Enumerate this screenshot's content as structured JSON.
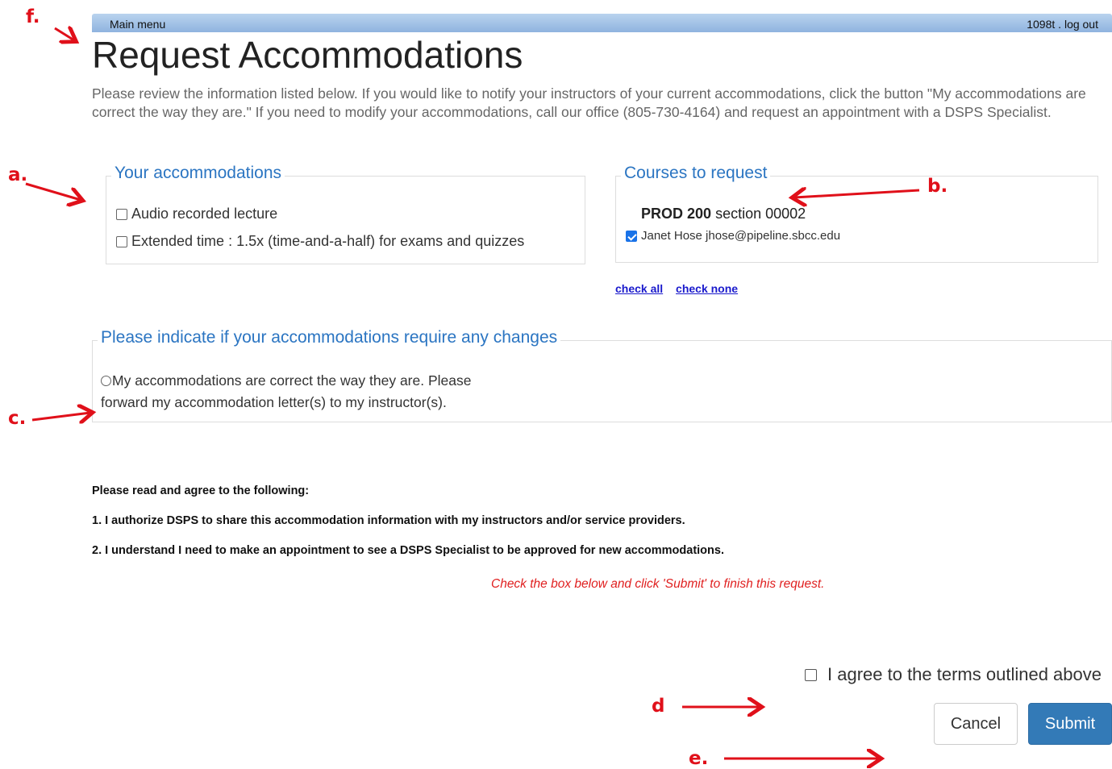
{
  "topbar": {
    "main_menu": "Main menu",
    "user": "1098t",
    "separator": ".",
    "logout": "log out"
  },
  "page_title": "Request Accommodations",
  "intro": "Please review the information listed below. If you would like to notify your instructors of your current accommodations, click the button \"My accommodations are correct the way they are.\" If you need to modify your accommodations, call our office (805-730-4164) and request an appointment with a DSPS Specialist.",
  "accommodations": {
    "legend": "Your accommodations",
    "items": [
      {
        "label": "Audio recorded lecture",
        "checked": false
      },
      {
        "label": "Extended time : 1.5x (time-and-a-half) for exams and quizzes",
        "checked": false
      }
    ]
  },
  "courses": {
    "legend": "Courses to request",
    "course_code": "PROD 200",
    "course_section": "section 00002",
    "student": {
      "label": "Janet Hose jhose@pipeline.sbcc.edu",
      "checked": true
    },
    "check_all": "check all",
    "check_none": "check none"
  },
  "changes": {
    "legend": "Please indicate if your accommodations require any changes",
    "option_line1": "My accommodations are correct the way they are. Please",
    "option_line2": "forward my accommodation letter(s) to my instructor(s)."
  },
  "terms": {
    "heading": "Please read and agree to the following:",
    "items": [
      "1.  I authorize DSPS to share this accommodation information with my instructors and/or service providers.",
      "2.  I understand I need to make an appointment to see a DSPS Specialist to be approved for new accommodations."
    ],
    "instruction": "Check the box below and click 'Submit' to finish this request."
  },
  "agree_label": "I agree to the terms outlined above",
  "buttons": {
    "cancel": "Cancel",
    "submit": "Submit"
  },
  "annotations": {
    "a": "a.",
    "b": "b.",
    "c": "c.",
    "d": "d",
    "e": "e.",
    "f": "f."
  },
  "colors": {
    "annotation": "#e0101a",
    "legend": "#2b75c2",
    "submit": "#337ab7",
    "instruction": "#e02020"
  }
}
